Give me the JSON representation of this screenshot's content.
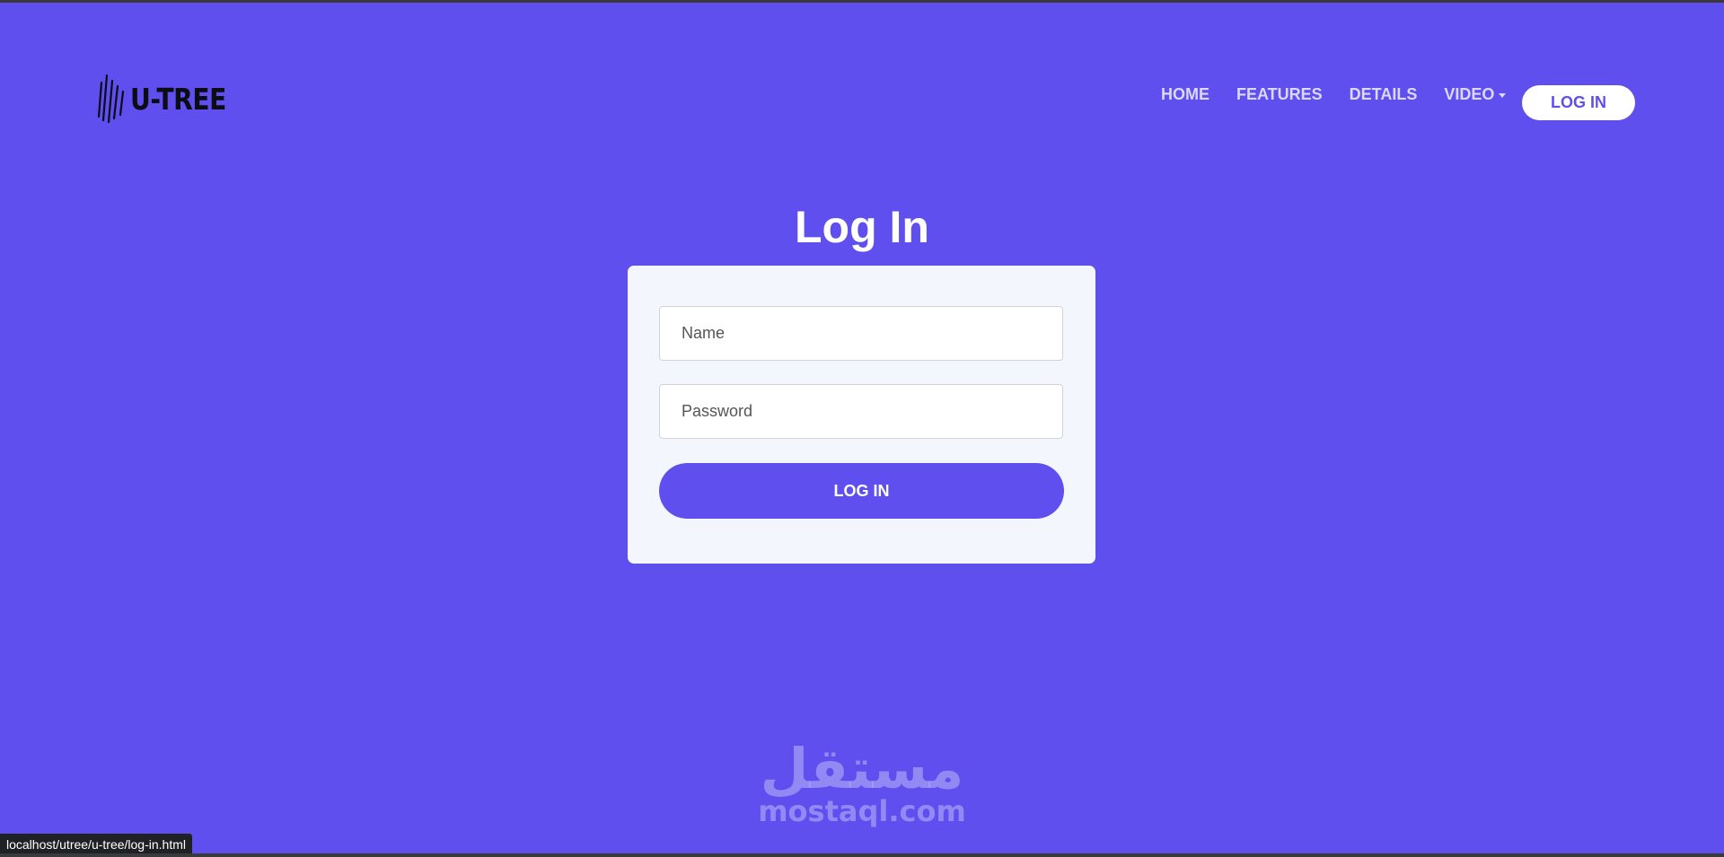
{
  "brand": {
    "name": "U-TREE",
    "logo_icon": "logo-mark-icon"
  },
  "nav": {
    "items": [
      {
        "label": "HOME"
      },
      {
        "label": "FEATURES"
      },
      {
        "label": "DETAILS"
      },
      {
        "label": "VIDEO",
        "has_dropdown": true
      }
    ],
    "login_label": "LOG IN"
  },
  "page": {
    "title": "Log In"
  },
  "form": {
    "name_placeholder": "Name",
    "name_value": "",
    "password_placeholder": "Password",
    "password_value": "",
    "submit_label": "LOG IN"
  },
  "watermark": {
    "arabic": "مستقل",
    "latin": "mostaql.com"
  },
  "status_bar": {
    "url": "localhost/utree/u-tree/log-in.html"
  },
  "colors": {
    "background": "#5f4fee",
    "card": "#f3f6fd",
    "accent": "#5f4fee",
    "nav_text": "#dcd8ff",
    "white": "#ffffff"
  }
}
